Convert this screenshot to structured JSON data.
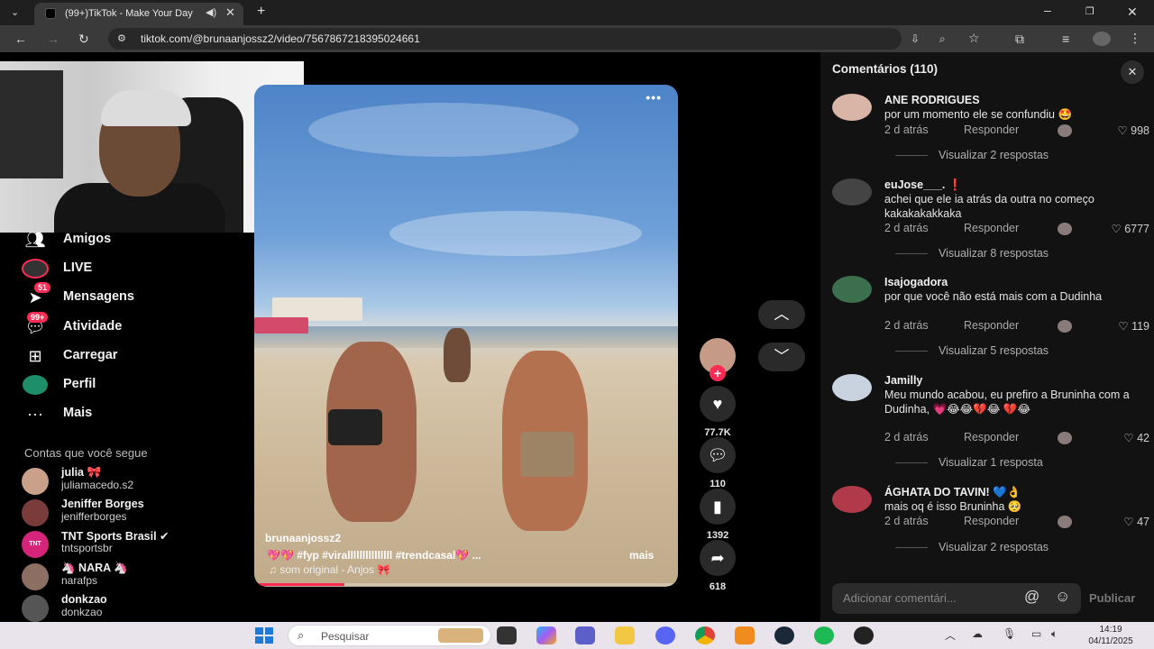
{
  "browser": {
    "tab_title": "(99+)TikTok - Make Your Day",
    "url": "tiktok.com/@brunaanjossz2/video/7567867218395024661"
  },
  "sidebar": {
    "items": [
      {
        "label": "Amigos",
        "icon": "friends-icon"
      },
      {
        "label": "LIVE",
        "icon": "live-icon"
      },
      {
        "label": "Mensagens",
        "icon": "messages-icon",
        "badge": "51"
      },
      {
        "label": "Atividade",
        "icon": "activity-icon",
        "badge": "99+"
      },
      {
        "label": "Carregar",
        "icon": "upload-icon"
      },
      {
        "label": "Perfil",
        "icon": "profile-icon"
      },
      {
        "label": "Mais",
        "icon": "more-icon"
      }
    ],
    "following_title": "Contas que você segue",
    "accounts": [
      {
        "name": "julia 🎀",
        "handle": "juliamacedo.s2"
      },
      {
        "name": "Jeniffer Borges",
        "handle": "jenifferborges"
      },
      {
        "name": "TNT Sports Brasil ✔",
        "handle": "tntsportsbr"
      },
      {
        "name": "🦄 NARA 🦄",
        "handle": "narafps"
      },
      {
        "name": "donkzao",
        "handle": "donkzao"
      }
    ]
  },
  "video": {
    "author": "brunaanjossz2",
    "caption": "💖💖 #fyp⁠ #viralllllllllllllll #trendcasal💖 ...",
    "more": "mais",
    "sound": "♫ som original - Anjos 🎀",
    "menu": "•••"
  },
  "actions": {
    "likes": "77.7K",
    "comments": "110",
    "saves": "1392",
    "shares": "618"
  },
  "comments_panel": {
    "title": "Comentários (110)",
    "reply_label": "Responder",
    "input_placeholder": "Adicionar comentári...",
    "post_label": "Publicar",
    "items": [
      {
        "user": "ANE RODRIGUES",
        "text": "por um momento ele se confundiu 🤩",
        "time": "2 d atrás",
        "likes": "998",
        "view": "Visualizar 2 respostas"
      },
      {
        "user": "euJose___. ❗",
        "text": "achei que ele ia atrás da outra no começo kakakakakkaka",
        "time": "2 d atrás",
        "likes": "6777",
        "view": "Visualizar 8 respostas"
      },
      {
        "user": "Isajogadora",
        "text": "por que você não está mais com a Dudinha",
        "time": "2 d atrás",
        "likes": "119",
        "view": "Visualizar 5 respostas"
      },
      {
        "user": "Jamilly",
        "text": "Meu mundo acabou, eu prefiro a Bruninha com a Dudinha, 💗😂😂💔😂 💔😂",
        "time": "2 d atrás",
        "likes": "42",
        "view": "Visualizar 1 resposta"
      },
      {
        "user": "ÁGHATA DO TAVIN! 💙👌",
        "text": "mais oq é isso Bruninha 🥺",
        "time": "2 d atrás",
        "likes": "47",
        "view": "Visualizar 2 respostas"
      }
    ]
  },
  "taskbar": {
    "search_placeholder": "Pesquisar",
    "time": "14:19",
    "date": "04/11/2025"
  }
}
